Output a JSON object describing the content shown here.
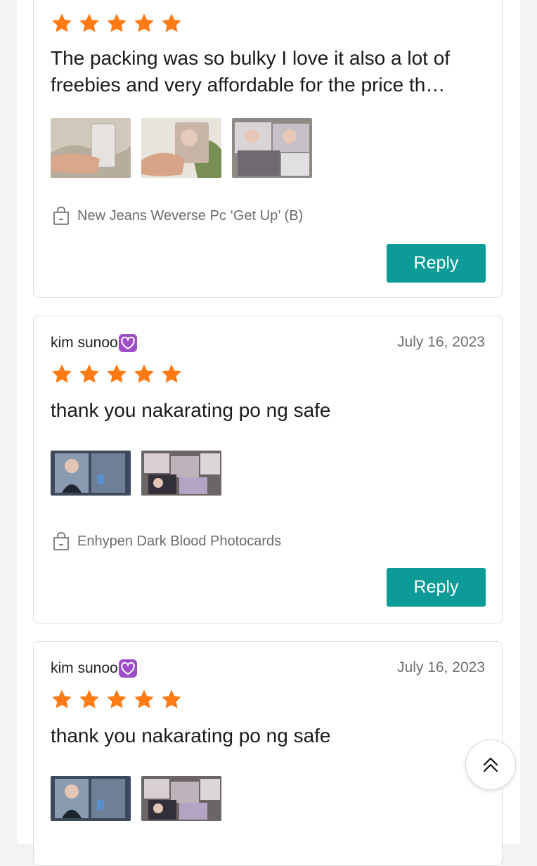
{
  "reviews": [
    {
      "user": "",
      "date": "",
      "stars": 5,
      "text": "The packing was so bulky I love it also a lot of freebies and very affordable for the price th…",
      "photos": [
        "photocard-in-sleeve",
        "photocard-girl",
        "photocards-spread"
      ],
      "product": "New Jeans Weverse Pc ‘Get Up’ (B)",
      "reply_label": "Reply"
    },
    {
      "user": "kim sunoo",
      "date": "July 16, 2023",
      "stars": 5,
      "text": "thank you nakarating po ng safe",
      "photos": [
        "photocard-binder",
        "photocards-spread"
      ],
      "product": "Enhypen Dark Blood Photocards",
      "reply_label": "Reply"
    },
    {
      "user": "kim sunoo",
      "date": "July 16, 2023",
      "stars": 5,
      "text": "thank you nakarating po ng safe",
      "photos": [
        "photocard-binder",
        "photocards-spread"
      ]
    }
  ],
  "icons": {
    "star": "star-icon",
    "bag": "shopping-bag-icon",
    "heart": "purple-heart-emoji",
    "scroll_top": "double-chevron-up-icon"
  },
  "colors": {
    "star": "#fe7a15",
    "accent": "#0d9b97",
    "heart_bg": "#9c4dc7"
  }
}
